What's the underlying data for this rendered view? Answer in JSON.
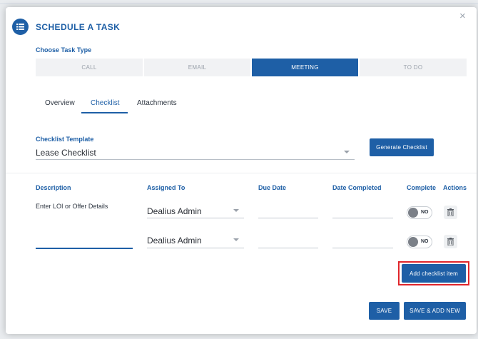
{
  "dialog": {
    "title": "SCHEDULE A TASK",
    "close_symbol": "×",
    "header_icon": "list-icon"
  },
  "task_type": {
    "label": "Choose Task Type",
    "options": [
      {
        "label": "CALL",
        "active": false
      },
      {
        "label": "EMAIL",
        "active": false
      },
      {
        "label": "MEETING",
        "active": true
      },
      {
        "label": "TO DO",
        "active": false
      }
    ]
  },
  "tabs": [
    {
      "label": "Overview",
      "active": false
    },
    {
      "label": "Checklist",
      "active": true
    },
    {
      "label": "Attachments",
      "active": false
    }
  ],
  "checklist_template": {
    "label": "Checklist Template",
    "value": "Lease Checklist",
    "generate_button": "Generate Checklist"
  },
  "table": {
    "headers": {
      "description": "Description",
      "assigned_to": "Assigned To",
      "due_date": "Due Date",
      "date_completed": "Date Completed",
      "complete": "Complete",
      "actions": "Actions"
    },
    "rows": [
      {
        "description": "Enter LOI or Offer Details",
        "assigned_to": "Dealius Admin",
        "due_date": "",
        "date_completed": "",
        "complete": "NO"
      },
      {
        "description": "",
        "assigned_to": "Dealius Admin",
        "due_date": "",
        "date_completed": "",
        "complete": "NO"
      }
    ]
  },
  "add_item_button": "Add checklist item",
  "footer": {
    "save": "SAVE",
    "save_add_new": "SAVE & ADD NEW"
  },
  "colors": {
    "accent": "#1e5fa6",
    "highlight": "#e0262b"
  }
}
